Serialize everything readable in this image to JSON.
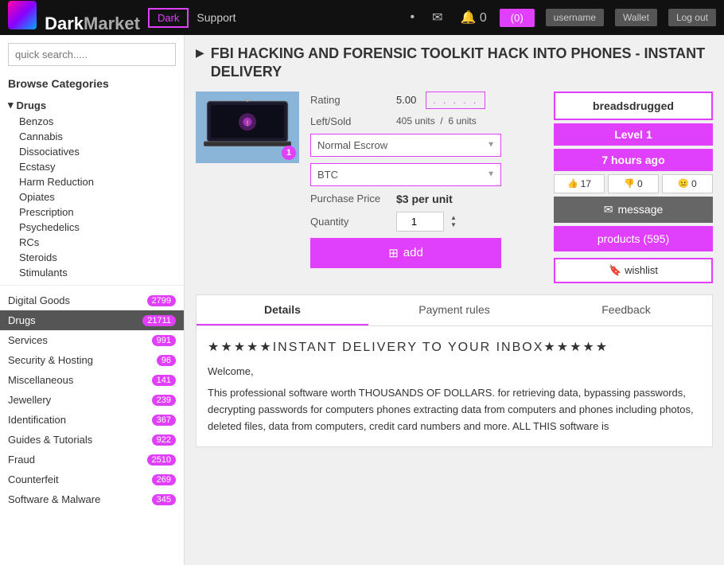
{
  "header": {
    "logo_text": "DarkMarket",
    "dark_btn": "Dark",
    "support": "Support",
    "cart_label": "(0)",
    "btn1": "username",
    "btn2": "Wallet",
    "btn3": "Log out"
  },
  "sidebar": {
    "search_placeholder": "quick search.....",
    "browse_title": "Browse Categories",
    "drugs_category": "Drugs",
    "drug_children": [
      "Benzos",
      "Cannabis",
      "Dissociatives",
      "Ecstasy",
      "Harm Reduction",
      "Opiates",
      "Prescription",
      "Psychedelics",
      "RCs",
      "Steroids",
      "Stimulants"
    ],
    "nav_items": [
      {
        "label": "Digital Goods",
        "count": "2799",
        "active": false
      },
      {
        "label": "Drugs",
        "count": "21711",
        "active": true
      },
      {
        "label": "Services",
        "count": "991",
        "active": false
      },
      {
        "label": "Security & Hosting",
        "count": "96",
        "active": false
      },
      {
        "label": "Miscellaneous",
        "count": "141",
        "active": false
      },
      {
        "label": "Jewellery",
        "count": "239",
        "active": false
      },
      {
        "label": "Identification",
        "count": "367",
        "active": false
      },
      {
        "label": "Guides & Tutorials",
        "count": "922",
        "active": false
      },
      {
        "label": "Fraud",
        "count": "2510",
        "active": false
      },
      {
        "label": "Counterfeit",
        "count": "269",
        "active": false
      },
      {
        "label": "Software & Malware",
        "count": "345",
        "active": false
      }
    ]
  },
  "product": {
    "title": "FBI HACKING AND FORENSIC TOOLKIT HACK INTO PHONES - INSTANT DELIVERY",
    "rating_value": "5.00",
    "left_units": "405 units",
    "sold_units": "6 units",
    "escrow_option": "Normal Escrow",
    "currency_option": "BTC",
    "purchase_label": "Purchase Price",
    "price": "$3 per unit",
    "quantity_label": "Quantity",
    "quantity_value": "1",
    "add_label": "add"
  },
  "seller": {
    "name": "breadsdrugged",
    "level": "Level 1",
    "time_ago": "7 hours ago",
    "stat1": "17",
    "stat2": "0",
    "stat3": "0",
    "message_btn": "message",
    "products_btn": "products (595)",
    "wishlist_btn": "wishlist"
  },
  "tabs": {
    "details_label": "Details",
    "payment_label": "Payment rules",
    "feedback_label": "Feedback",
    "active": "details",
    "content_stars": "★★★★★INSTANT DELIVERY TO YOUR INBOX★★★★★",
    "content_welcome": "Welcome,",
    "content_body": "This professional software worth THOUSANDS OF DOLLARS. for retrieving data, bypassing passwords, decrypting passwords for computers phones extracting data from computers and phones including photos, deleted files, data from computers, credit card numbers and more. ALL THIS software is"
  }
}
